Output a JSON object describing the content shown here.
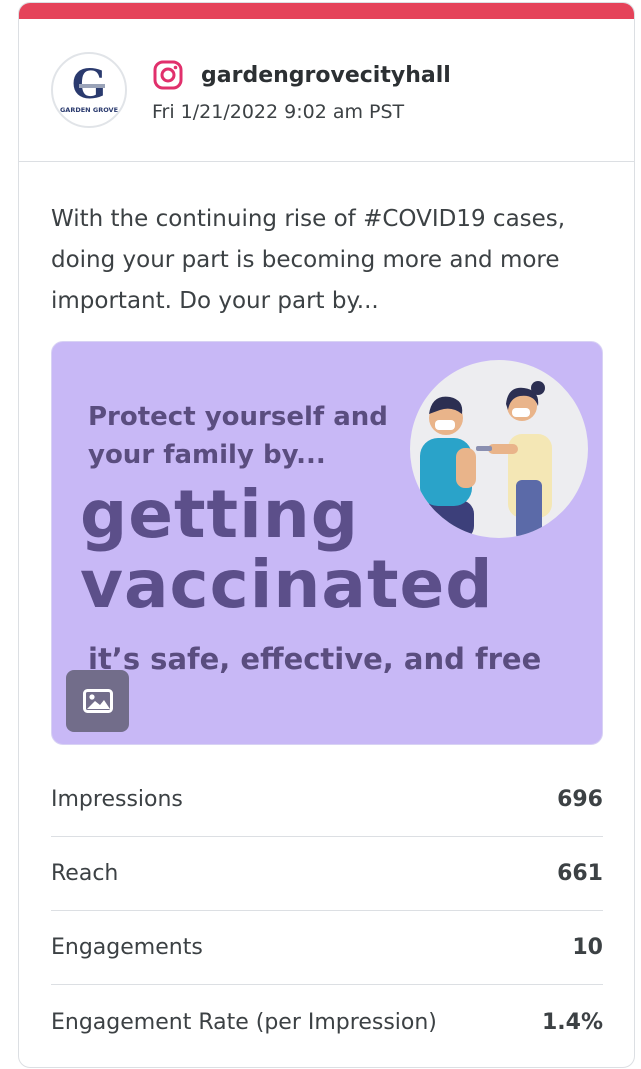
{
  "post": {
    "account": "gardengrovecityhall",
    "timestamp": "Fri 1/21/2022 9:02 am PST",
    "avatar_text": "GARDEN GROVE",
    "caption": "With the continuing rise of #COVID19 cases, doing your part is becoming more and more important. Do your part by..."
  },
  "media": {
    "line1": "Protect yourself and",
    "line2": "your family by...",
    "line3": "getting",
    "line4": "vaccinated",
    "line5": "it’s safe, effective, and free",
    "badge_icon": "image-icon"
  },
  "metrics": [
    {
      "label": "Impressions",
      "value": "696"
    },
    {
      "label": "Reach",
      "value": "661"
    },
    {
      "label": "Engagements",
      "value": "10"
    },
    {
      "label": "Engagement Rate (per Impression)",
      "value": "1.4%"
    }
  ],
  "colors": {
    "accent_bar": "#e5435a",
    "instagram": "#e1306c",
    "media_bg": "#c8b8f6"
  }
}
